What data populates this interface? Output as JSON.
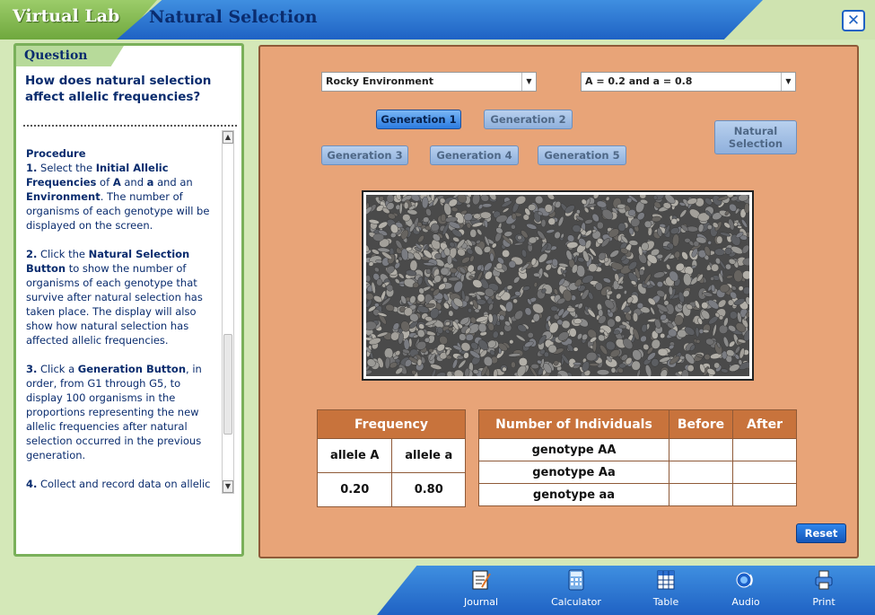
{
  "header": {
    "app_title": "Virtual Lab",
    "lab_title": "Natural Selection",
    "close_glyph": "✕"
  },
  "question": {
    "label": "Question",
    "text": "How does natural selection affect allelic frequencies?"
  },
  "procedure": {
    "heading": "Procedure",
    "steps": [
      {
        "num": "1.",
        "parts": [
          "Select the ",
          "Initial Allelic Frequencies",
          " of ",
          "A",
          " and ",
          "a",
          " and an ",
          "Environment",
          ". The number of organisms of each genotype will be displayed on the screen."
        ]
      },
      {
        "num": "2.",
        "parts": [
          "Click the ",
          "Natural Selection Button",
          " to show the number of organisms of each genotype that survive after natural selection has taken place. The display will also show how natural selection has affected allelic frequencies."
        ]
      },
      {
        "num": "3.",
        "parts": [
          "Click a  ",
          "Generation Button",
          ", in order, from G1 through G5, to display 100 organisms in the proportions representing the new allelic frequencies after natural selection occurred in the previous generation."
        ]
      },
      {
        "num": "4.",
        "parts": [
          "Collect and record data on allelic"
        ]
      }
    ]
  },
  "controls": {
    "environment_select": "Rocky Environment",
    "frequency_select": "A = 0.2 and a = 0.8",
    "generation_buttons": [
      "Generation 1",
      "Generation 2",
      "Generation 3",
      "Generation 4",
      "Generation 5"
    ],
    "active_generation": 0,
    "natural_selection_button": [
      "Natural",
      "Selection"
    ],
    "reset_button": "Reset"
  },
  "frequency_table": {
    "title": "Frequency",
    "headers": [
      "allele A",
      "allele a"
    ],
    "values": [
      "0.20",
      "0.80"
    ]
  },
  "individuals_table": {
    "headers": [
      "Number of Individuals",
      "Before",
      "After"
    ],
    "rows": [
      {
        "genotype": "genotype AA",
        "before": "",
        "after": ""
      },
      {
        "genotype": "genotype Aa",
        "before": "",
        "after": ""
      },
      {
        "genotype": "genotype aa",
        "before": "",
        "after": ""
      }
    ]
  },
  "toolbar": {
    "items": [
      {
        "label": "Journal",
        "icon": "journal-icon"
      },
      {
        "label": "Calculator",
        "icon": "calculator-icon"
      },
      {
        "label": "Table",
        "icon": "table-icon"
      },
      {
        "label": "Audio",
        "icon": "audio-icon"
      },
      {
        "label": "Print",
        "icon": "print-icon"
      }
    ]
  },
  "colors": {
    "header_blue": "#1f62c4",
    "header_green": "#6fa83e",
    "panel_orange": "#e8a478",
    "table_header": "#c8733c",
    "text_navy": "#0a2c6e"
  }
}
